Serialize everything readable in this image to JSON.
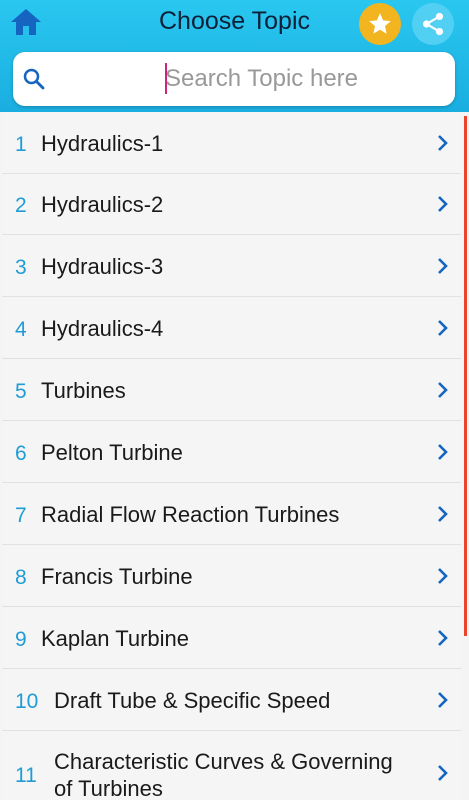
{
  "header": {
    "title": "Choose Topic",
    "home_icon": "home-icon",
    "favorite_icon": "star-icon",
    "share_icon": "share-icon",
    "accent_color": "#1fb8e8",
    "favorite_color": "#f2b51f"
  },
  "search": {
    "placeholder": "Search Topic here",
    "value": ""
  },
  "topics": [
    {
      "number": "1",
      "label": "Hydraulics-1"
    },
    {
      "number": "2",
      "label": "Hydraulics-2"
    },
    {
      "number": "3",
      "label": "Hydraulics-3"
    },
    {
      "number": "4",
      "label": "Hydraulics-4"
    },
    {
      "number": "5",
      "label": "Turbines"
    },
    {
      "number": "6",
      "label": "Pelton Turbine"
    },
    {
      "number": "7",
      "label": "Radial Flow Reaction Turbines"
    },
    {
      "number": "8",
      "label": "Francis Turbine"
    },
    {
      "number": "9",
      "label": "Kaplan Turbine"
    },
    {
      "number": "10",
      "label": "Draft Tube & Specific Speed"
    },
    {
      "number": "11",
      "label_line1": "Characteristic Curves & Governing",
      "label_line2": "of Turbines"
    }
  ]
}
